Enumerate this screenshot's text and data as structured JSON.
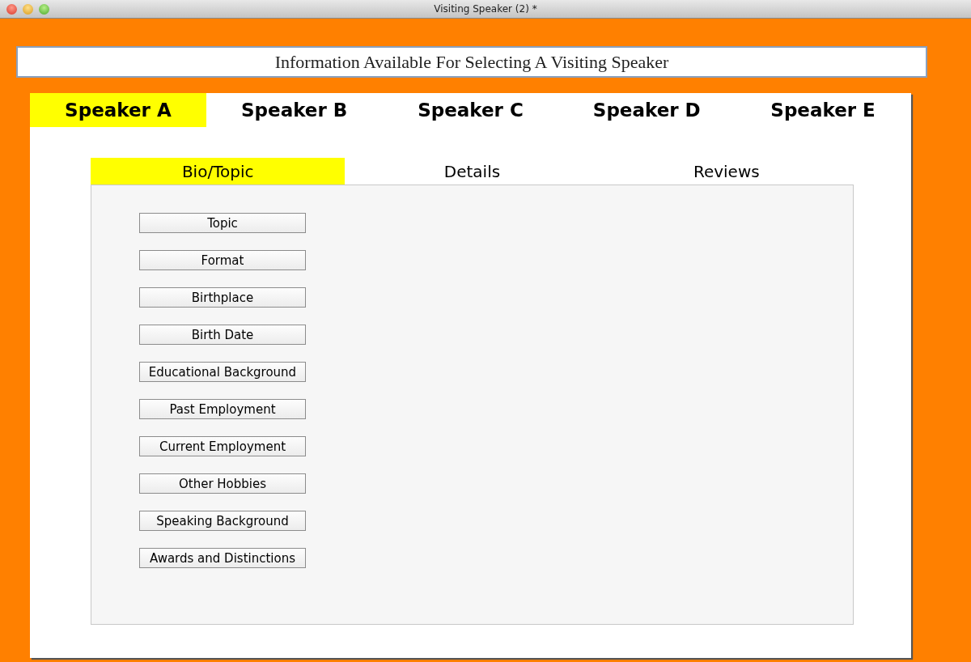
{
  "window": {
    "title": "Visiting Speaker (2) *"
  },
  "header_field": {
    "value": "Information Available For Selecting A Visiting Speaker"
  },
  "speaker_tabs": [
    {
      "label": "Speaker A",
      "selected": true
    },
    {
      "label": "Speaker B",
      "selected": false
    },
    {
      "label": "Speaker C",
      "selected": false
    },
    {
      "label": "Speaker D",
      "selected": false
    },
    {
      "label": "Speaker E",
      "selected": false
    }
  ],
  "section_tabs": [
    {
      "label": "Bio/Topic",
      "selected": true
    },
    {
      "label": "Details",
      "selected": false
    },
    {
      "label": "Reviews",
      "selected": false
    }
  ],
  "buttons": [
    "Topic",
    "Format",
    "Birthplace",
    "Birth Date",
    "Educational Background",
    "Past Employment",
    "Current Employment",
    "Other Hobbies",
    "Speaking Background",
    "Awards and Distinctions"
  ]
}
